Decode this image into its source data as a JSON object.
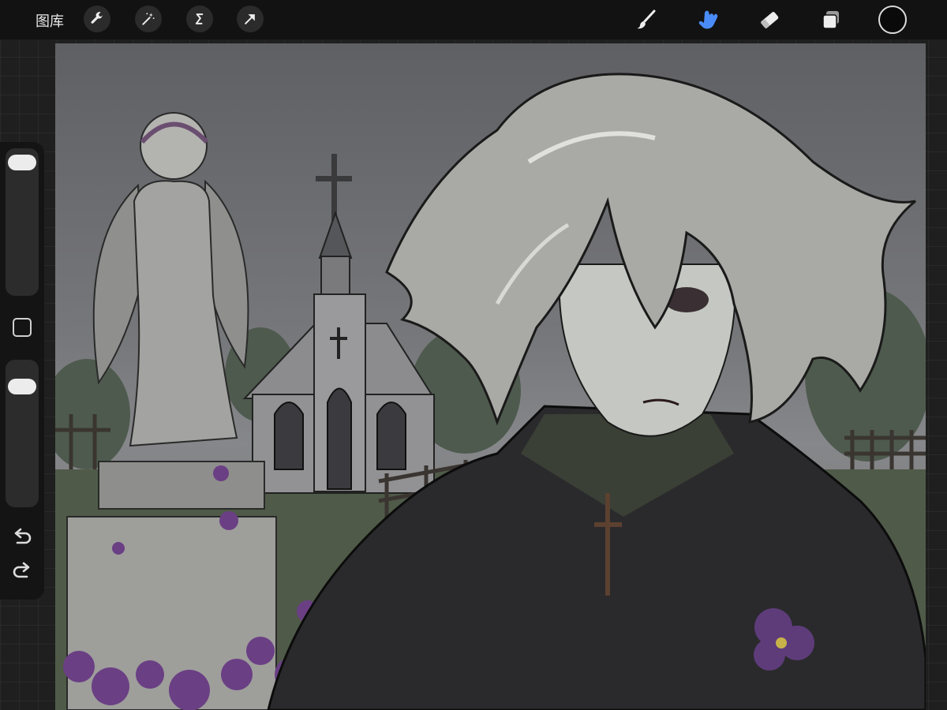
{
  "toolbar": {
    "gallery_label": "图库",
    "left_tools": [
      "wrench-icon",
      "magic-wand-icon",
      "selection-icon",
      "transform-arrow-icon"
    ],
    "right_tools": [
      "brush-icon",
      "smudge-icon",
      "eraser-icon",
      "layers-icon"
    ],
    "active_tool": "smudge-icon",
    "active_color": "#4a8cf7",
    "current_color": "#0a0a0a"
  },
  "sidebar": {
    "brush_size_level": 0.97,
    "opacity_level": 0.87,
    "buttons": [
      "modify-square-icon",
      "undo-icon",
      "redo-icon"
    ]
  },
  "canvas": {
    "artwork": "graveyard-angel-illustration"
  }
}
